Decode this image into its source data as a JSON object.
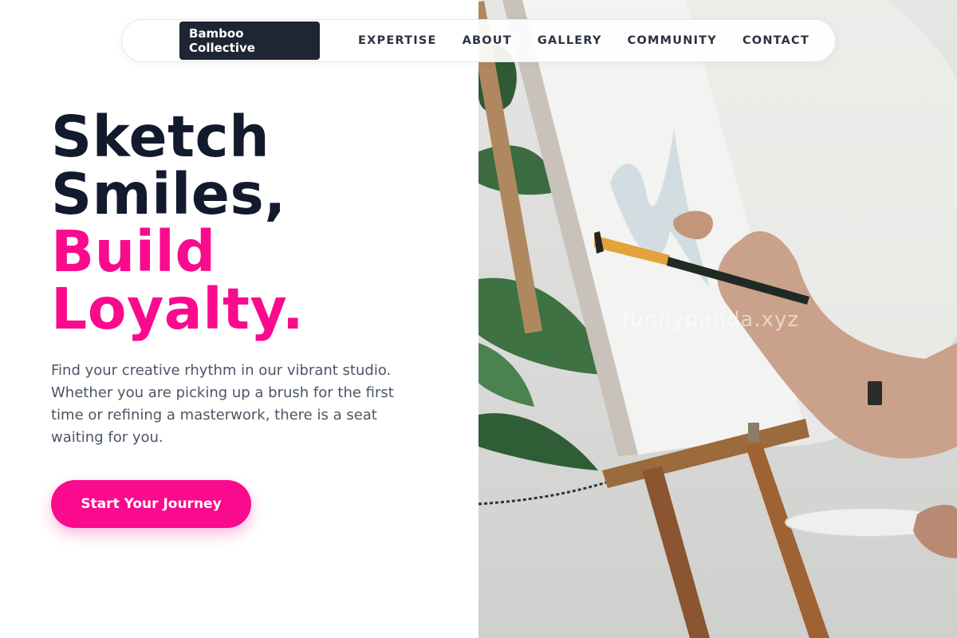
{
  "nav": {
    "brand": "Bamboo Collective",
    "links": [
      "EXPERTISE",
      "ABOUT",
      "GALLERY",
      "COMMUNITY",
      "CONTACT"
    ]
  },
  "hero": {
    "title_line1": "Sketch",
    "title_line2": "Smiles,",
    "title_line3": "Build",
    "title_line4": "Loyalty.",
    "description": "Find your creative rhythm in our vibrant studio. Whether you are picking up a brush for the first time or refining a masterwork, there is a seat waiting for you.",
    "cta_label": "Start Your Journey"
  },
  "photo": {
    "watermark": "funnypanda.xyz",
    "icons": [
      "easel",
      "canvas",
      "paintbrush",
      "hand",
      "palette",
      "plant-leaves"
    ]
  },
  "colors": {
    "accent": "#fa0a8c",
    "heading": "#121a2e",
    "brand_bg": "#1e2533",
    "body_text": "#4b5565"
  }
}
